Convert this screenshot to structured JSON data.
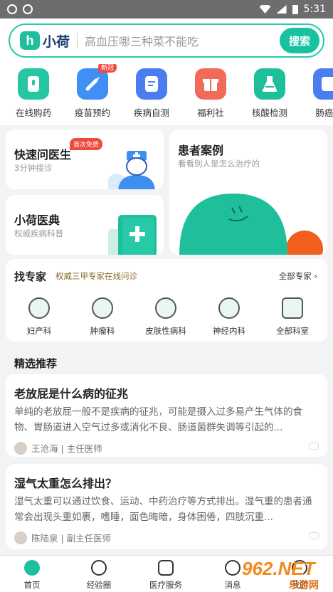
{
  "status_bar": {
    "time": "5:31"
  },
  "search": {
    "logo_text": "小荷",
    "logo_mark": "h",
    "placeholder": "高血压哪三种菜不能吃",
    "button": "搜索"
  },
  "quick_entries": [
    {
      "label": "在线购药",
      "icon": "pill-bottle-icon",
      "color": "#26c6a4"
    },
    {
      "label": "疫苗预约",
      "icon": "syringe-icon",
      "color": "#3f8ff5",
      "badge": "新冠"
    },
    {
      "label": "疾病自测",
      "icon": "clipboard-icon",
      "color": "#4b7cf0"
    },
    {
      "label": "福利社",
      "icon": "gift-icon",
      "color": "#f26a5a"
    },
    {
      "label": "核酸检测",
      "icon": "flask-icon",
      "color": "#1fbf9c"
    },
    {
      "label": "肠癌筛",
      "icon": "screening-icon",
      "color": "#4b7cf0"
    }
  ],
  "cards": {
    "quick_consult": {
      "title": "快速问医生",
      "sub": "3分钟接诊",
      "badge": "首次免费"
    },
    "encyclopedia": {
      "title": "小荷医典",
      "sub": "权威疾病科普"
    },
    "cases": {
      "title": "患者案例",
      "sub": "看看别人是怎么治疗的"
    }
  },
  "experts": {
    "title": "找专家",
    "sub": "权威三甲专家在线问诊",
    "all": "全部专家",
    "departments": [
      {
        "label": "妇产科",
        "icon": "uterus-icon"
      },
      {
        "label": "肿瘤科",
        "icon": "tumor-icon"
      },
      {
        "label": "皮肤性病科",
        "icon": "skin-icon"
      },
      {
        "label": "神经内科",
        "icon": "brain-icon"
      },
      {
        "label": "全部科室",
        "icon": "all-departments-icon"
      }
    ]
  },
  "picks": {
    "title": "精选推荐",
    "articles": [
      {
        "title": "老放屁是什么病的征兆",
        "text": "单纯的老放屁一般不是疾病的征兆，可能是摄入过多易产生气体的食物、胃肠道进入空气过多或消化不良、肠道菌群失调等引起的...",
        "author": "王沧海 | 主任医师"
      },
      {
        "title": "湿气太重怎么排出？",
        "text": "湿气太重可以通过饮食、运动、中药治疗等方式排出。湿气重的患者通常会出现头重如裹，嗜睡，面色晦暗，身体困倦，四肢沉重...",
        "author": "陈陆泉 | 副主任医师"
      }
    ]
  },
  "bottom_nav": [
    {
      "label": "首页",
      "icon": "home-icon",
      "active": true
    },
    {
      "label": "经验圈",
      "icon": "circle-icon"
    },
    {
      "label": "医疗服务",
      "icon": "medical-service-icon"
    },
    {
      "label": "消息",
      "icon": "message-icon"
    },
    {
      "label": "我的",
      "icon": "profile-icon"
    }
  ],
  "watermark": {
    "text": "962.NET",
    "sub": "乐游网"
  },
  "colors": {
    "brand": "#1fbf9c",
    "accent_red": "#f04a3e",
    "orange": "#f0601c"
  }
}
